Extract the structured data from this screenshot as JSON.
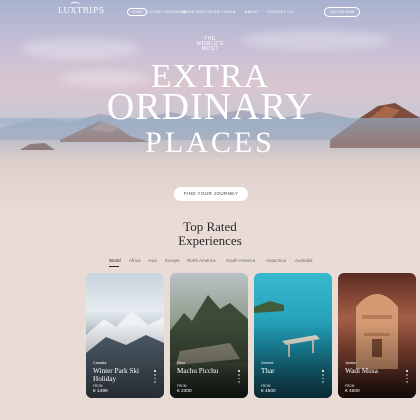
{
  "nav": {
    "logo": "LUXTRIPS",
    "items": [
      "HOME",
      "LUXURY PACKAGES",
      "BOOK WITH US",
      "SRI LANKA",
      "ABOUT",
      "CONTACT US"
    ],
    "cta": "CALL US NOW"
  },
  "hero": {
    "eyebrow_line1": "THE",
    "eyebrow_line2": "WORLD'S",
    "eyebrow_line3": "MOST",
    "line1": "EXTRA",
    "line2": "ORDINARY",
    "line3": "PLACES",
    "cta": "FIND YOUR JOURNEY"
  },
  "section": {
    "title_line1": "Top Rated",
    "title_line2": "Experiences"
  },
  "tabs": [
    "World",
    "Africa",
    "Asia",
    "Europe",
    "North America",
    "South America",
    "Antarctica",
    "Australia"
  ],
  "cards": [
    {
      "location": "Canada",
      "name": "Winter Park Ski Holiday",
      "from_label": "FROM",
      "price": "€ 1499"
    },
    {
      "location": "Peru",
      "name": "Machu Picchu",
      "from_label": "FROM",
      "price": "€ 2300"
    },
    {
      "location": "Greece",
      "name": "Thar",
      "from_label": "FROM",
      "price": "€ 4500"
    },
    {
      "location": "Jordan",
      "name": "Wadi Musa",
      "from_label": "FROM",
      "price": "€ 4500"
    }
  ],
  "colors": {
    "background": "#e9dbd6",
    "heading": "#2a2a2a"
  }
}
